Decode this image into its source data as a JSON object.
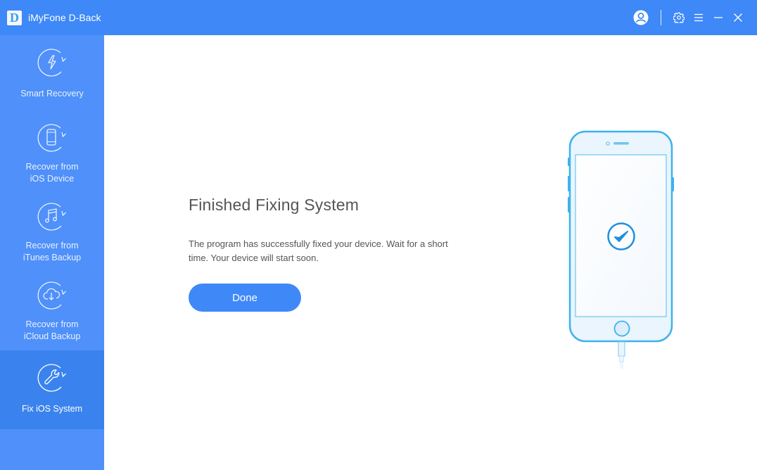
{
  "app": {
    "logo_letter": "D",
    "title": "iMyFone D-Back"
  },
  "titlebar": {
    "icons": [
      "user-account-icon",
      "settings-gear-icon",
      "menu-icon",
      "minimize-icon",
      "close-icon"
    ]
  },
  "sidebar": {
    "items": [
      {
        "label_line1": "Smart Recovery",
        "label_line2": "",
        "icon": "lightning-refresh-icon",
        "active": false
      },
      {
        "label_line1": "Recover from",
        "label_line2": "iOS Device",
        "icon": "phone-refresh-icon",
        "active": false
      },
      {
        "label_line1": "Recover from",
        "label_line2": "iTunes Backup",
        "icon": "music-note-refresh-icon",
        "active": false
      },
      {
        "label_line1": "Recover from",
        "label_line2": "iCloud Backup",
        "icon": "cloud-download-refresh-icon",
        "active": false
      },
      {
        "label_line1": "Fix iOS System",
        "label_line2": "",
        "icon": "wrench-refresh-icon",
        "active": true
      }
    ]
  },
  "main": {
    "heading": "Finished Fixing System",
    "description": "The program has successfully fixed your device. Wait for a short time. Your device will start soon.",
    "done_label": "Done",
    "illustration": "phone-with-checkmark"
  },
  "colors": {
    "titlebar": "#3e88f8",
    "sidebar": "#4f90fa",
    "sidebar_active": "#3a83ee",
    "accent": "#3f88f8",
    "phone_outline": "#3db2ee"
  }
}
